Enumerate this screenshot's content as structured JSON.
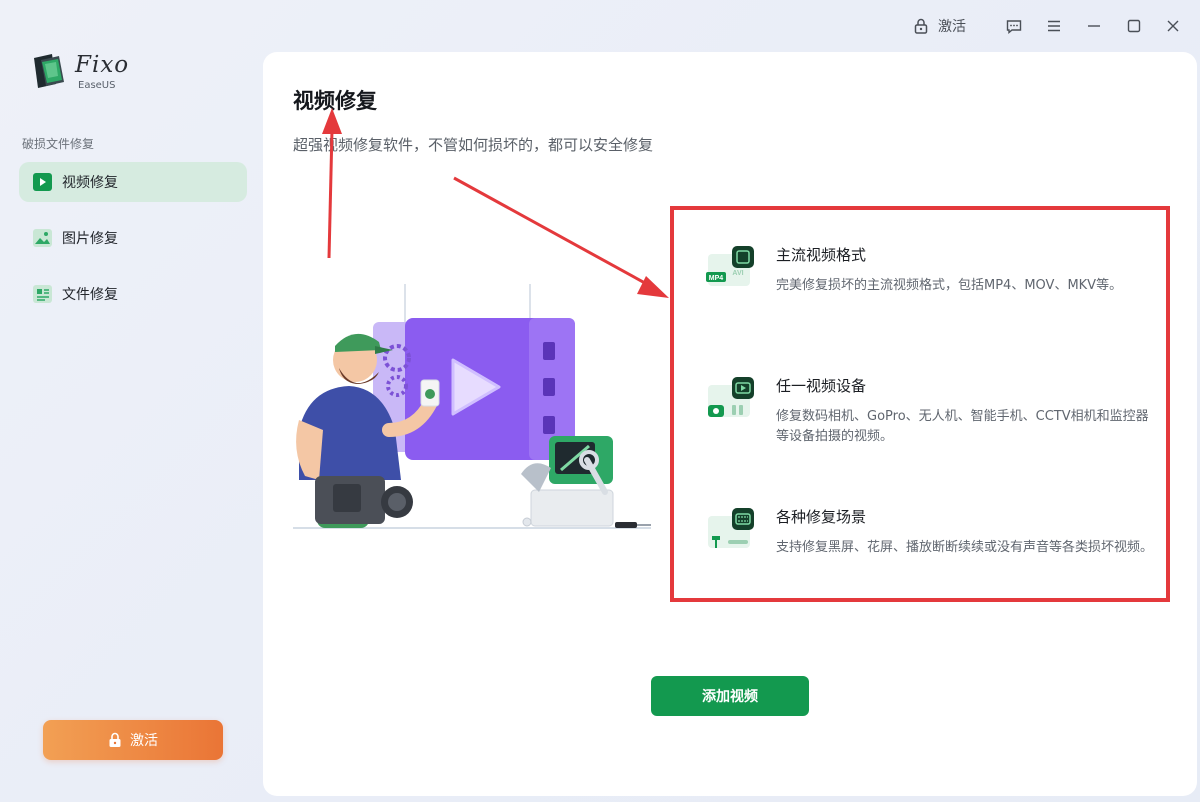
{
  "titlebar": {
    "activate_label": "激活"
  },
  "app": {
    "logo_name": "Fixo",
    "logo_sub": "EaseUS"
  },
  "sidebar": {
    "section_label": "破损文件修复",
    "items": [
      {
        "label": "视频修复",
        "icon": "video-icon",
        "active": true
      },
      {
        "label": "图片修复",
        "icon": "image-icon",
        "active": false
      },
      {
        "label": "文件修复",
        "icon": "document-icon",
        "active": false
      }
    ],
    "activate_label": "激活"
  },
  "main": {
    "title": "视频修复",
    "subtitle": "超强视频修复软件，不管如何损坏的，都可以安全修复",
    "features": [
      {
        "title": "主流视频格式",
        "desc": "完美修复损坏的主流视频格式，包括MP4、MOV、MKV等。",
        "badge": "MP4",
        "badge2": "AVI"
      },
      {
        "title": "任一视频设备",
        "desc": "修复数码相机、GoPro、无人机、智能手机、CCTV相机和监控器等设备拍摄的视频。"
      },
      {
        "title": "各种修复场景",
        "desc": "支持修复黑屏、花屏、播放断断续续或没有声音等各类损坏视频。"
      }
    ],
    "add_button": "添加视频"
  },
  "colors": {
    "accent": "#13994f",
    "active_nav": "#d6ebe0",
    "activate_gradient": [
      "#f2a054",
      "#ea7536"
    ],
    "highlight_box": "#e4393c",
    "illustration_purple": "#8b5cf0"
  }
}
